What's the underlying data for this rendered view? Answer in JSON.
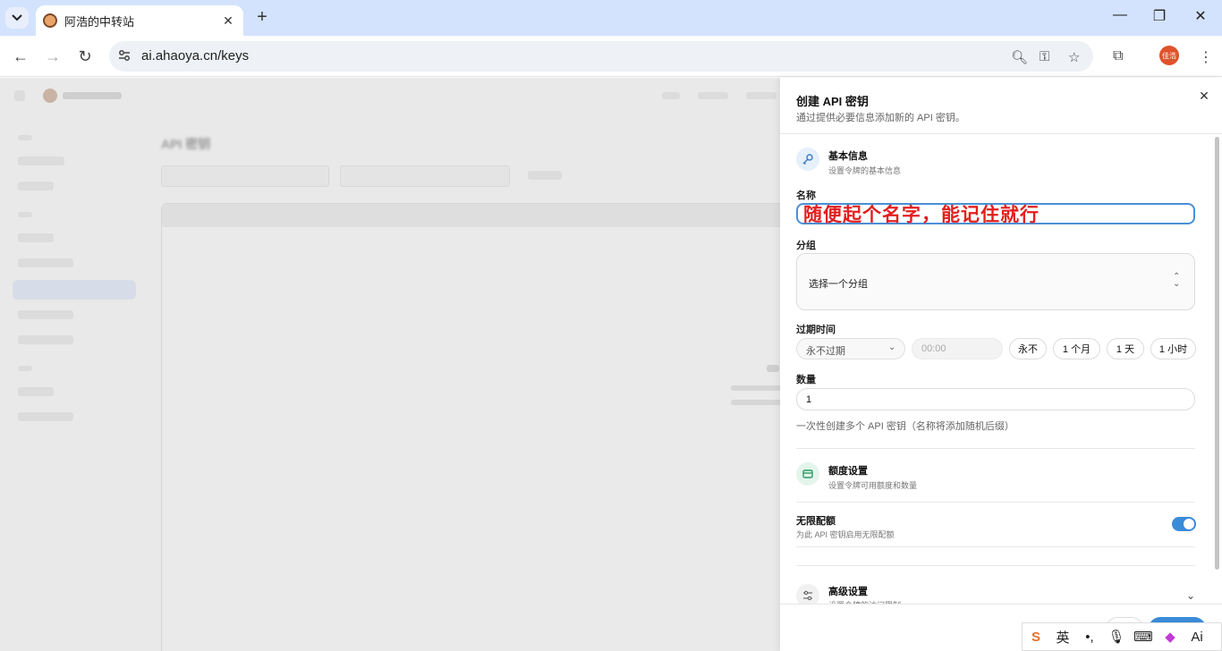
{
  "browser": {
    "tab_title": "阿浩的中转站",
    "url": "ai.ahaoya.cn/keys",
    "avatar_text": "佳浩"
  },
  "page": {
    "title": "API 密钥"
  },
  "drawer": {
    "title": "创建 API 密钥",
    "subtitle": "通过提供必要信息添加新的 API 密钥。",
    "basic": {
      "title": "基本信息",
      "subtitle": "设置令牌的基本信息"
    },
    "name_label": "名称",
    "name_value": "随便起个名字，能记住就行",
    "group_label": "分组",
    "group_value": "选择一个分组",
    "expiry_label": "过期时间",
    "expiry_value": "永不过期",
    "time_value": "00:00",
    "expiry_chips": [
      "永不",
      "1 个月",
      "1 天",
      "1 小时"
    ],
    "quantity_label": "数量",
    "quantity_value": "1",
    "quantity_hint": "一次性创建多个 API 密钥（名称将添加随机后缀）",
    "quota": {
      "title": "额度设置",
      "subtitle": "设置令牌可用额度和数量"
    },
    "unlimited_title": "无限配额",
    "unlimited_subtitle": "为此 API 密钥启用无限配额",
    "advanced": {
      "title": "高级设置",
      "subtitle": "设置令牌的访问限制"
    }
  },
  "ime": {
    "lang": "英",
    "ai": "Ai"
  },
  "colors": {
    "accent": "#3a8bd8",
    "annotation": "#e31e1e",
    "tabstrip": "#d3e3fd"
  }
}
